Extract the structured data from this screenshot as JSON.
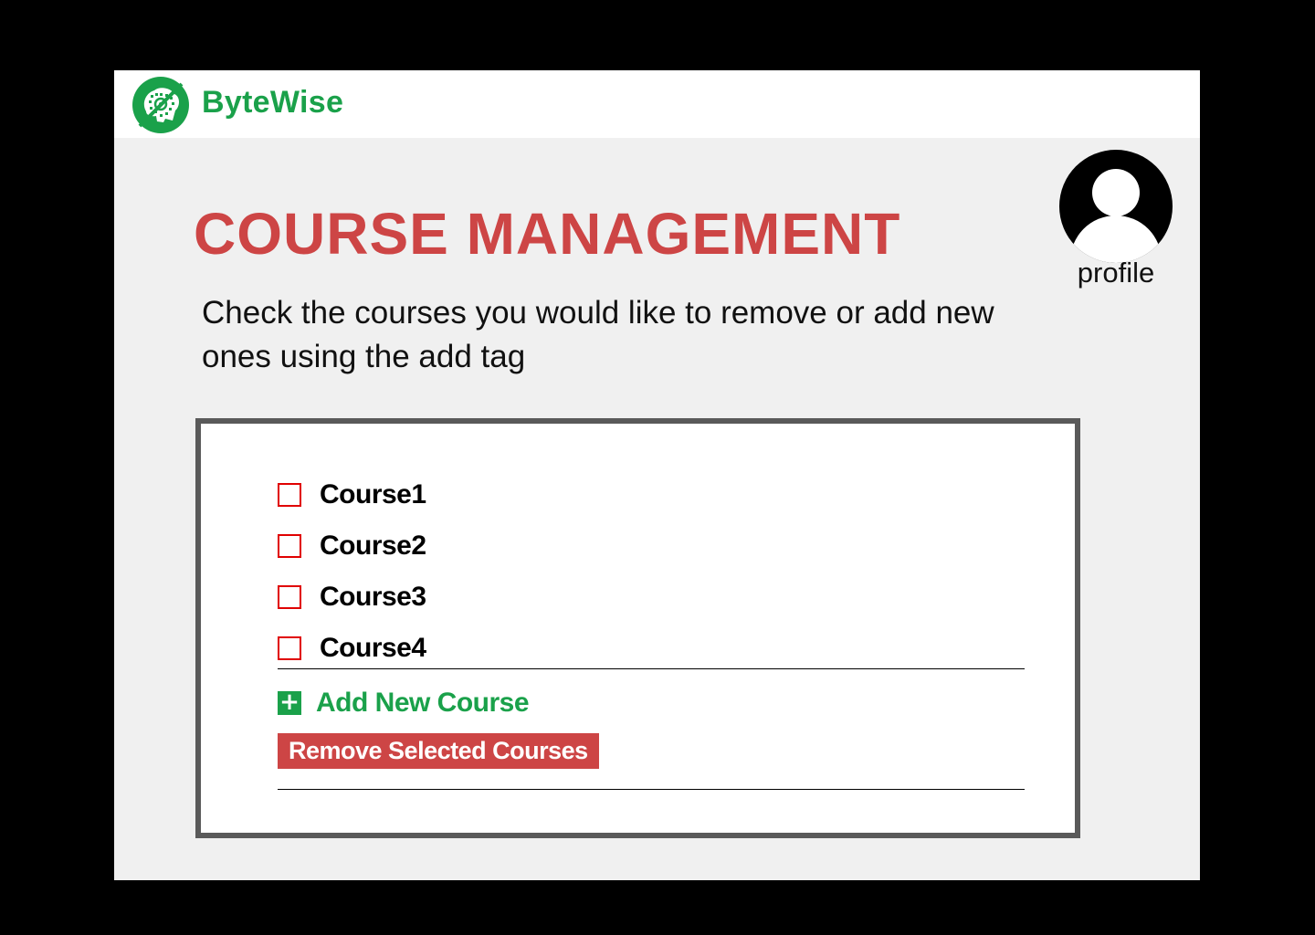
{
  "header": {
    "brand": "ByteWise",
    "logo_icon": "brain-chip-logo-icon",
    "brand_color": "#1aa14a"
  },
  "main": {
    "title": "COURSE MANAGEMENT",
    "subtitle": "Check the courses you would like to remove or add new ones using the add tag",
    "title_color": "#cd4545"
  },
  "profile": {
    "label": "profile",
    "icon": "user-avatar-icon"
  },
  "courses": [
    {
      "label": "Course1",
      "checked": false
    },
    {
      "label": "Course2",
      "checked": false
    },
    {
      "label": "Course3",
      "checked": false
    },
    {
      "label": "Course4",
      "checked": false
    }
  ],
  "actions": {
    "add_label": "Add New Course",
    "add_icon": "plus-icon",
    "remove_label": "Remove Selected Courses"
  },
  "colors": {
    "accent_green": "#1aa14a",
    "danger_red": "#cd4545",
    "checkbox_border": "#e00000",
    "panel_border": "#5a5a5a",
    "background": "#f0f0f0"
  }
}
